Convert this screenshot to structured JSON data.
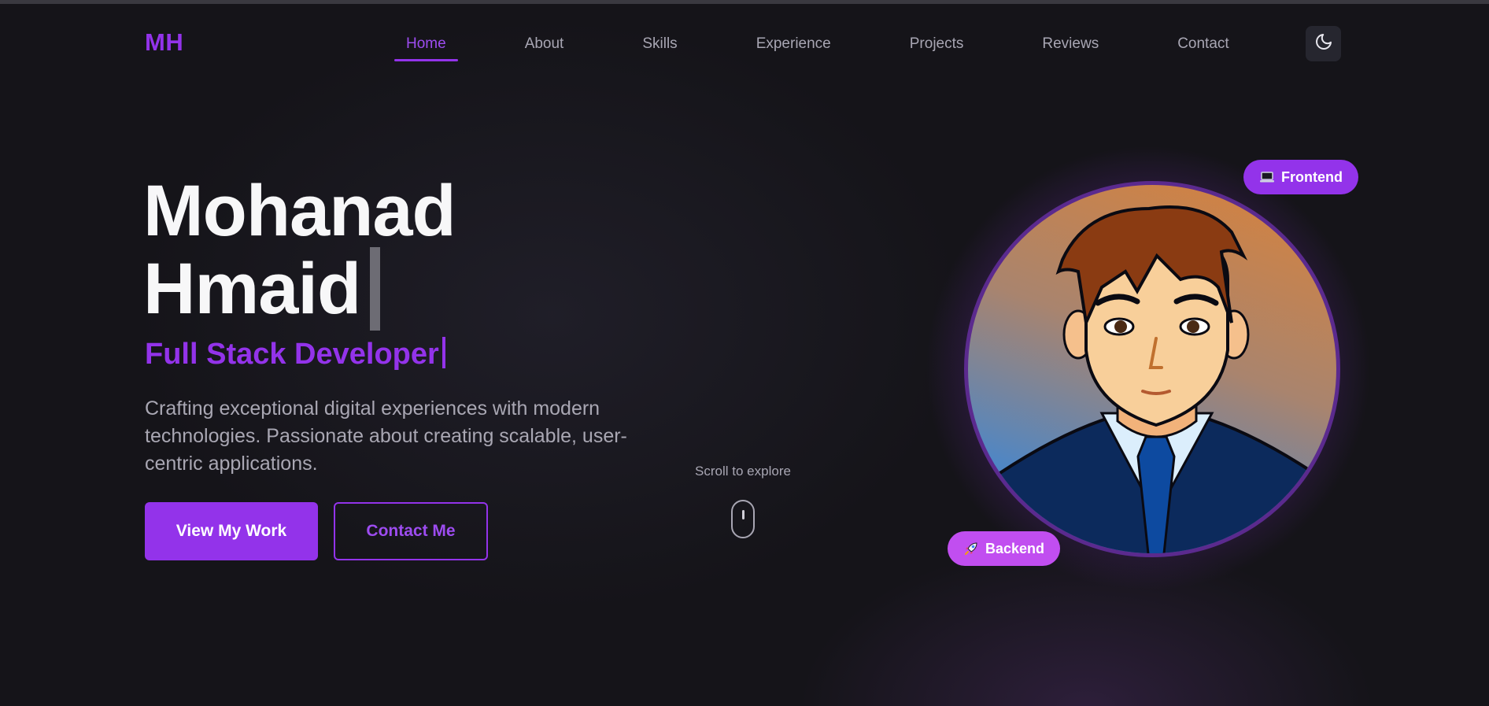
{
  "nav": {
    "logo": "MH",
    "items": [
      {
        "label": "Home",
        "active": true
      },
      {
        "label": "About"
      },
      {
        "label": "Skills"
      },
      {
        "label": "Experience"
      },
      {
        "label": "Projects"
      },
      {
        "label": "Reviews"
      },
      {
        "label": "Contact"
      }
    ],
    "theme_icon": "moon-icon"
  },
  "hero": {
    "first_name": "Mohanad",
    "last_name": "Hmaid",
    "role": "Full Stack Developer",
    "description": "Crafting exceptional digital experiences with modern technologies. Passionate about creating scalable, user-centric applications.",
    "primary_button": "View My Work",
    "secondary_button": "Contact Me"
  },
  "scroll_hint": {
    "text": "Scroll to explore",
    "icon": "mouse-icon"
  },
  "avatar": {
    "icon": "developer-avatar-illustration",
    "badge_frontend": {
      "label": "Frontend",
      "icon": "laptop-icon"
    },
    "badge_backend": {
      "label": "Backend",
      "icon": "rocket-icon"
    }
  },
  "colors": {
    "accent": "#9333ea",
    "background": "#151419",
    "text": "#f7f7f8",
    "muted": "#a8a6b3"
  }
}
